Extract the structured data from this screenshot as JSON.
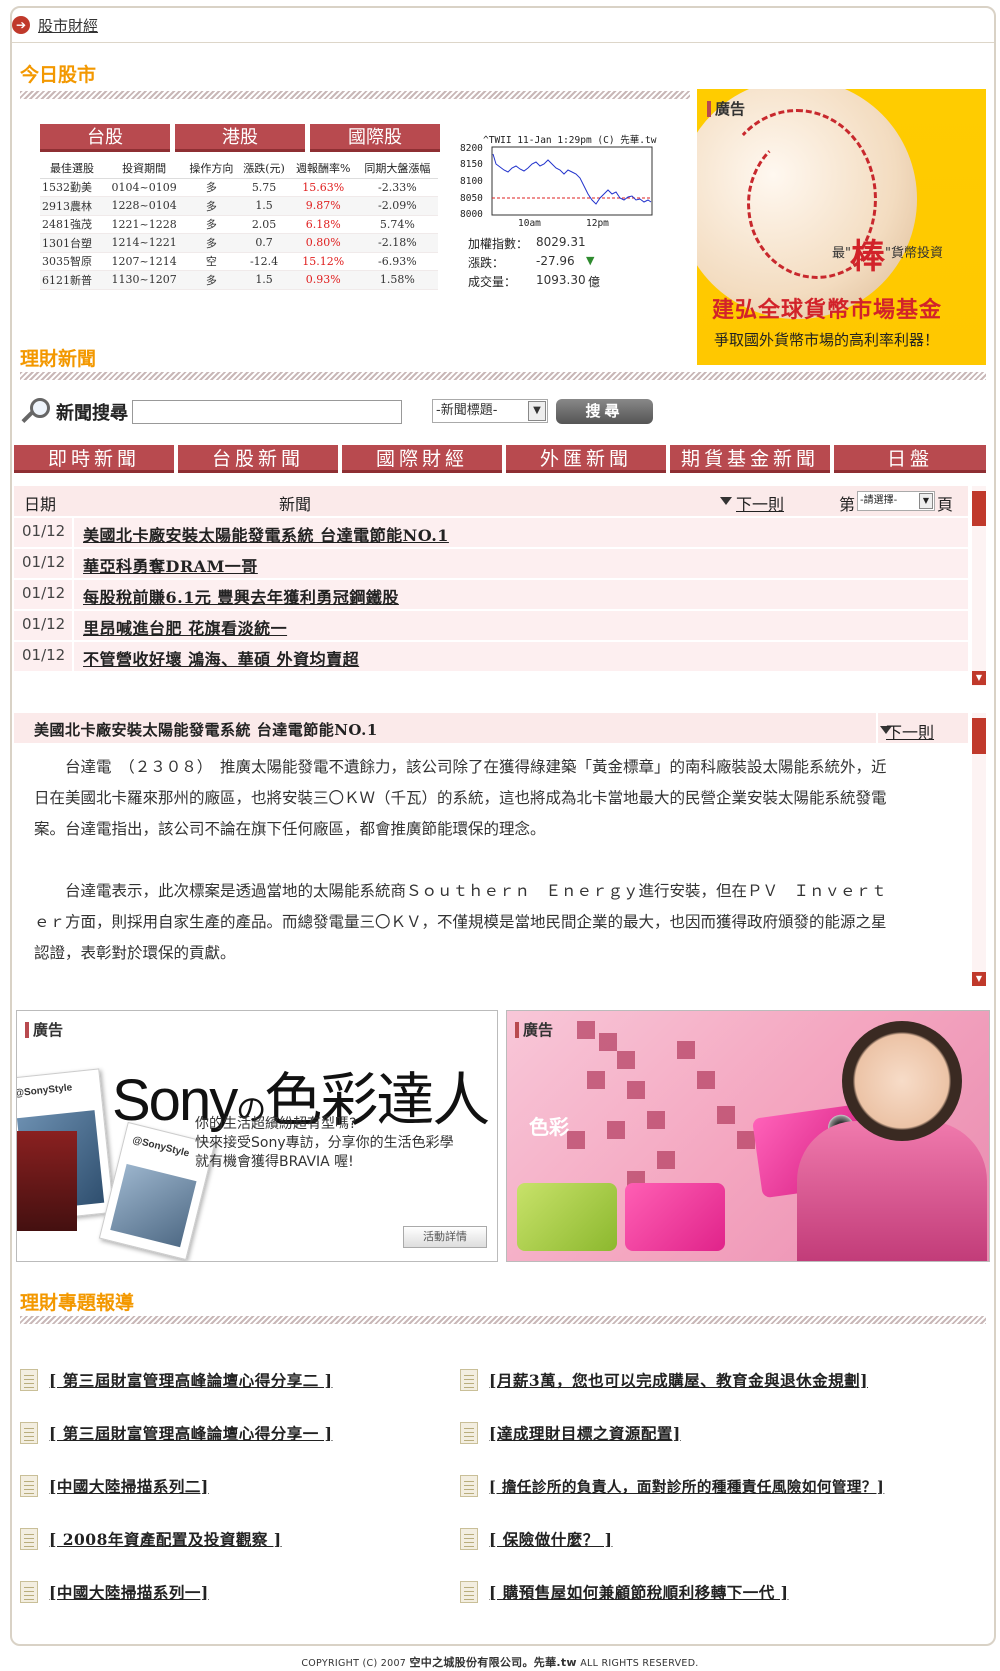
{
  "breadcrumb": {
    "label": "股市財經"
  },
  "today_market": {
    "title": "今日股市",
    "tabs": [
      "台股",
      "港股",
      "國際股"
    ],
    "table": {
      "headers": [
        "最佳選股",
        "投資期間",
        "操作方向",
        "漲跌(元)",
        "週報酬率%",
        "同期大盤漲幅"
      ],
      "rows": [
        [
          "1532勤美",
          "0104~0109",
          "多",
          "5.75",
          "15.63%",
          "-2.33%"
        ],
        [
          "2913農林",
          "1228~0104",
          "多",
          "1.5",
          "9.87%",
          "-2.09%"
        ],
        [
          "2481強茂",
          "1221~1228",
          "多",
          "2.05",
          "6.18%",
          "5.74%"
        ],
        [
          "1301台塑",
          "1214~1221",
          "多",
          "0.7",
          "0.80%",
          "-2.18%"
        ],
        [
          "3035智原",
          "1207~1214",
          "空",
          "-12.4",
          "15.12%",
          "-6.93%"
        ],
        [
          "6121新普",
          "1130~1207",
          "多",
          "1.5",
          "0.93%",
          "1.58%"
        ]
      ]
    },
    "chart": {
      "caption": "^TWII 11-Jan 1:29pm (C) 先華.tw",
      "y_ticks": [
        "8200",
        "8150",
        "8100",
        "8050",
        "8000"
      ],
      "x_ticks": [
        "10am",
        "12pm"
      ]
    },
    "index": {
      "labels": [
        "加權指數：",
        "漲跌：",
        "成交量："
      ],
      "values": [
        "8029.31",
        "-27.96",
        "1093.30"
      ],
      "unit": "億",
      "down_color": "#2e8b2e"
    }
  },
  "ad_top": {
    "tag": "廣告",
    "slogan_pre": "最\"",
    "slogan_big": "棒",
    "slogan_post": "\"貨幣投資",
    "fund": "建弘全球貨幣市場基金",
    "sub": "爭取國外貨幣市場的高利率利器！"
  },
  "finance_news": {
    "title": "理財新聞",
    "search_label": "新聞搜尋",
    "search_value": "",
    "select_value": "-新聞標題-",
    "search_button": "搜尋",
    "tabs": [
      "即時新聞",
      "台股新聞",
      "國際財經",
      "外匯新聞",
      "期貨基金新聞",
      "日盤"
    ],
    "list_header": {
      "date": "日期",
      "news": "新聞",
      "next": "下一則",
      "page_pre": "第",
      "page_select": "-請選擇-",
      "page_post": "頁"
    },
    "items": [
      {
        "date": "01/12",
        "title": "美國北卡廠安裝太陽能發電系統 台達電節能NO.1"
      },
      {
        "date": "01/12",
        "title": "華亞科勇奪DRAM一哥"
      },
      {
        "date": "01/12",
        "title": "每股稅前賺6.1元 豐興去年獲利勇冠鋼鐵股"
      },
      {
        "date": "01/12",
        "title": "里昂喊進台肥 花旗看淡統一"
      },
      {
        "date": "01/12",
        "title": "不管營收好壞 鴻海、華碩 外資均賣超"
      }
    ],
    "article": {
      "title": "美國北卡廠安裝太陽能發電系統 台達電節能NO.1",
      "next": "下一則",
      "paragraphs": [
        "台達電　（２３０８）　推廣太陽能發電不遺餘力，該公司除了在獲得綠建築「黃金標章」的南科廠裝設太陽能系統外，近日在美國北卡羅來那州的廠區，也將安裝三〇ＫＷ（千瓦）的系統，這也將成為北卡當地最大的民營企業安裝太陽能系統發電案。台達電指出，該公司不論在旗下任何廠區，都會推廣節能環保的理念。",
        "台達電表示，此次標案是透過當地的太陽能系統商Ｓｏｕｔｈｅｒｎ　Ｅｎｅｒｇｙ進行安裝，但在ＰＶ　Ｉｎｖｅｒｔｅｒ方面，則採用自家生產的產品。而總發電量三〇ＫＶ，不僅規模是當地民間企業的最大，也因而獲得政府頒發的能源之星認證，表彰對於環保的貢獻。"
      ]
    }
  },
  "ads_bottom": {
    "left": {
      "tag": "廣告",
      "logo_a": "Sony",
      "logo_b": "の",
      "logo_c": "色彩達人",
      "lines": [
        "你的生活超繽紛超有型嗎?",
        "快來接受Sony專訪，分享你的生活色彩學",
        "就有機會獲得BRAVIA 喔!"
      ],
      "card_label": "@SonyStyle",
      "button": "活動詳情"
    },
    "right": {
      "tag": "廣告",
      "word": "色彩"
    }
  },
  "topics": {
    "title": "理財專題報導",
    "left": [
      "[ 第三屆財富管理高峰論壇心得分享二 ]",
      "[ 第三屆財富管理高峰論壇心得分享一 ]",
      "[中國大陸掃描系列二]",
      "[ 2008年資產配置及投資觀察 ]",
      "[中國大陸掃描系列一]"
    ],
    "right": [
      "[月薪3萬，您也可以完成購屋、教育金與退休金規劃]",
      "[達成理財目標之資源配置]",
      "[ 擔任診所的負責人，面對診所的種種責任風險如何管理？]",
      "[ 保險做什麼？ ]",
      "[ 購預售屋如何兼顧節稅順利移轉下一代 ]"
    ]
  },
  "footer": {
    "pre": "COPYRIGHT (C) 2007 ",
    "company": "空中之城股份有限公司。先華.tw",
    "post": " ALL RIGHTS RESERVED."
  },
  "colors": {
    "accent": "#b84a4f",
    "title_orange": "#f39800",
    "up_red": "#e02020"
  }
}
